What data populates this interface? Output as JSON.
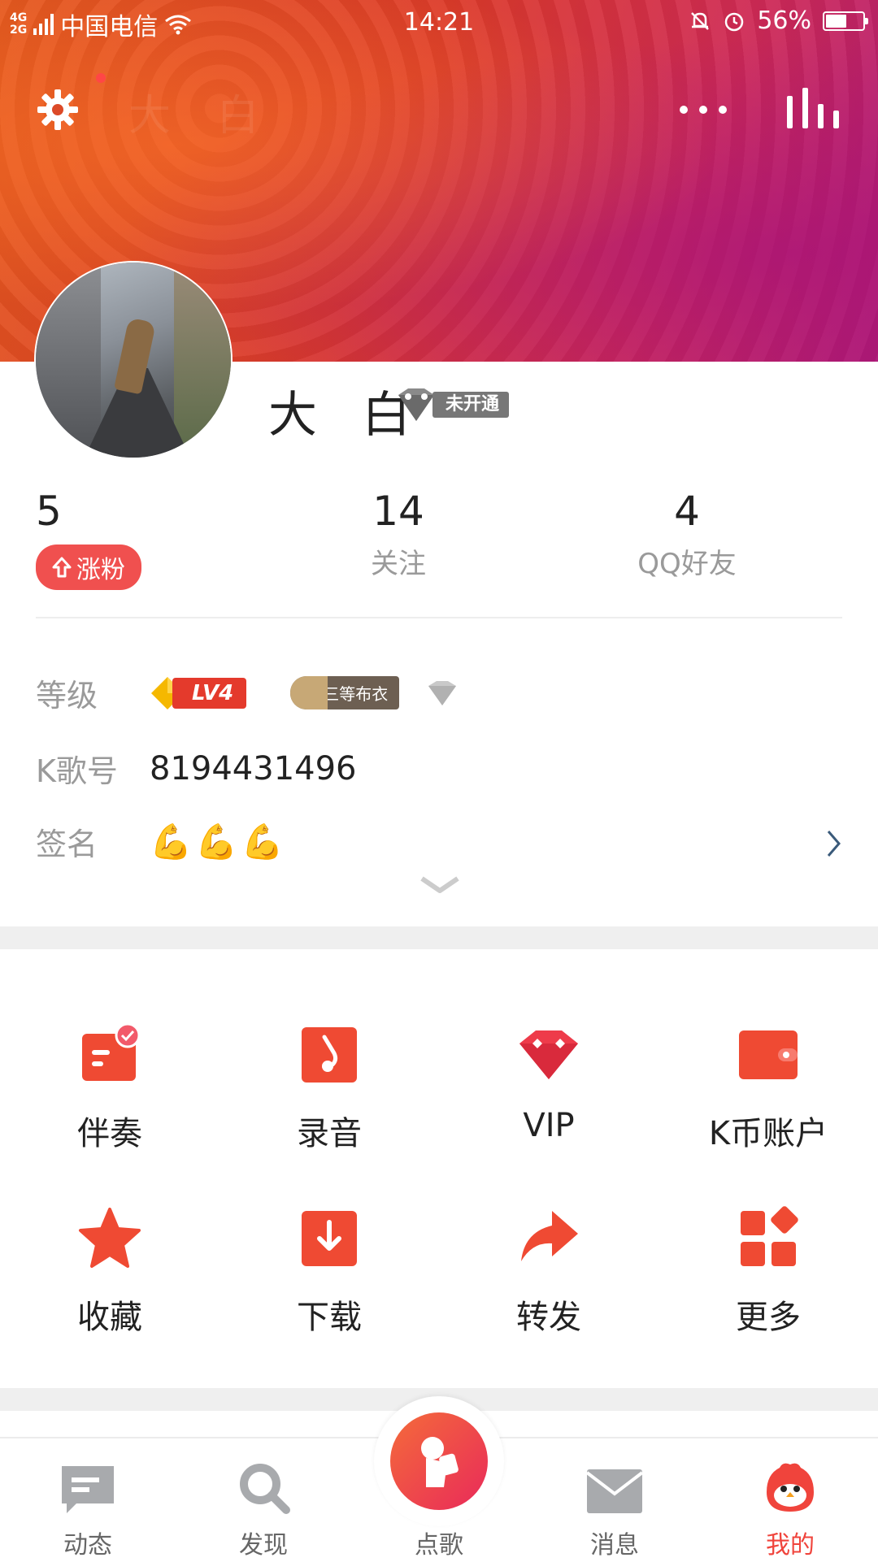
{
  "status_bar": {
    "network": [
      "4G",
      "2G"
    ],
    "carrier": "中国电信",
    "time": "14:21",
    "battery": "56%",
    "battery_level": 0.56
  },
  "header": {
    "faint_title": "大 白"
  },
  "profile": {
    "name": "大 白",
    "vip_status": "未开通"
  },
  "stats": [
    {
      "value": "5",
      "label": "涨粉"
    },
    {
      "value": "14",
      "label": "关注"
    },
    {
      "value": "4",
      "label": "QQ好友"
    }
  ],
  "info": {
    "level_label": "等级",
    "level_badge": "LV4",
    "noble_badge": "三等布衣",
    "id_label": "K歌号",
    "id_value": "8194431496",
    "signature_label": "签名",
    "signature_value": "💪💪💪"
  },
  "grid": [
    {
      "label": "伴奏",
      "icon": "accompaniment-icon"
    },
    {
      "label": "录音",
      "icon": "recording-icon"
    },
    {
      "label": "VIP",
      "icon": "vip-diamond-icon"
    },
    {
      "label": "K币账户",
      "icon": "wallet-icon"
    },
    {
      "label": "收藏",
      "icon": "star-icon"
    },
    {
      "label": "下载",
      "icon": "download-icon"
    },
    {
      "label": "转发",
      "icon": "share-icon"
    },
    {
      "label": "更多",
      "icon": "more-grid-icon"
    }
  ],
  "tabs": [
    {
      "label": "动态",
      "icon": "feed-icon"
    },
    {
      "label": "发现",
      "icon": "search-icon"
    },
    {
      "label": "点歌",
      "icon": "microphone-icon"
    },
    {
      "label": "消息",
      "icon": "mail-icon"
    },
    {
      "label": "我的",
      "icon": "mascot-icon"
    }
  ],
  "colors": {
    "accent": "#f0443c",
    "header_start": "#e4571e",
    "header_end": "#b01a78"
  }
}
